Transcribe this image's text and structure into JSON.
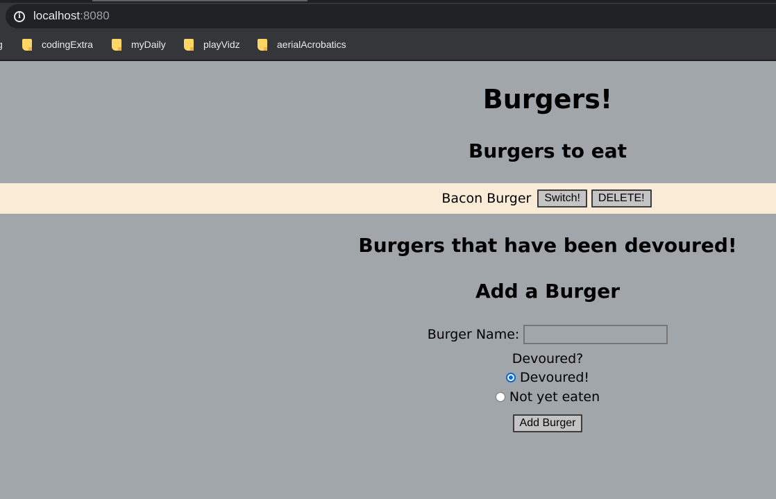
{
  "browser": {
    "url_host": "localhost",
    "url_port": ":8080",
    "bookmarks": [
      {
        "label": "g",
        "icon": "folder-icon"
      },
      {
        "label": "codingExtra",
        "icon": "folder-icon"
      },
      {
        "label": "myDaily",
        "icon": "folder-icon"
      },
      {
        "label": "playVidz",
        "icon": "folder-icon"
      },
      {
        "label": "aerialAcrobatics",
        "icon": "folder-icon"
      }
    ]
  },
  "page": {
    "title": "Burgers!",
    "to_eat_heading": "Burgers to eat",
    "to_eat": [
      {
        "name": "Bacon Burger",
        "switch_label": "Switch!",
        "delete_label": "DELETE!"
      }
    ],
    "devoured_heading": "Burgers that have been devoured!",
    "add_heading": "Add a Burger",
    "form": {
      "name_label": "Burger Name:",
      "name_value": "",
      "devoured_question": "Devoured?",
      "options": [
        {
          "label": "Devoured!",
          "checked": true
        },
        {
          "label": "Not yet eaten",
          "checked": false
        }
      ],
      "submit_label": "Add Burger"
    }
  },
  "colors": {
    "page_background": "#a0a6aa",
    "row_background": "#faebd7",
    "radio_accent": "#0a66d6"
  }
}
